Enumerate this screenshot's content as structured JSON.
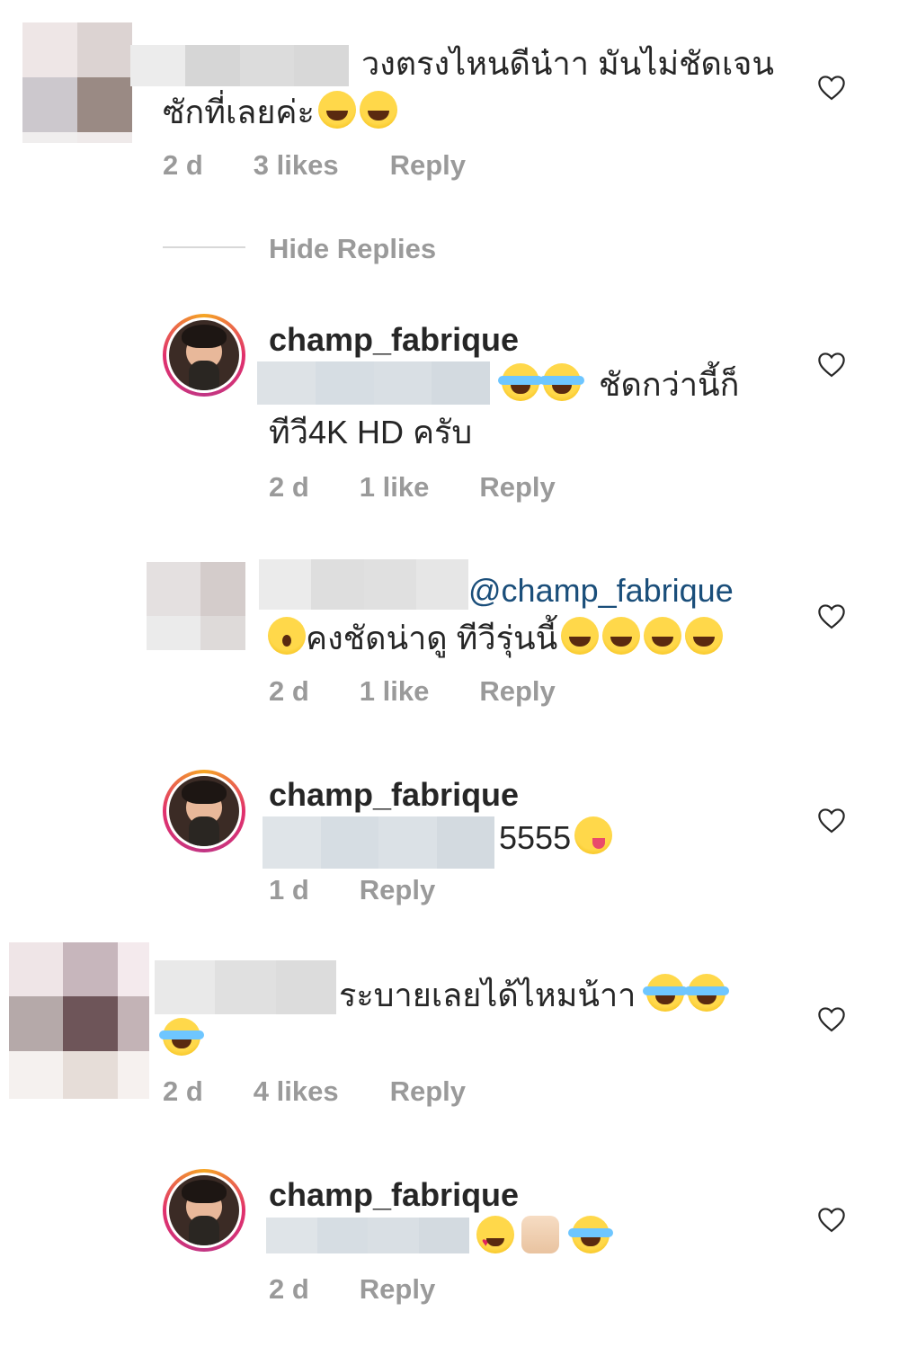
{
  "comments": [
    {
      "line1": "วงตรงไหนดีน๋าา มันไม่ชัดเจน",
      "line2": "ซักที่เลยค่ะ",
      "time": "2 d",
      "likes": "3 likes",
      "reply": "Reply"
    },
    {
      "hide_replies": "Hide Replies"
    },
    {
      "username": "champ_fabrique",
      "line1": "ชัดกว่านี้ก็",
      "line2": "ทีวี4K HD ครับ",
      "time": "2 d",
      "likes": "1 like",
      "reply": "Reply"
    },
    {
      "mention": "@champ_fabrique",
      "line2": "คงชัดน่าดู ทีวีรุ่นนี้",
      "time": "2 d",
      "likes": "1 like",
      "reply": "Reply"
    },
    {
      "username": "champ_fabrique",
      "line1": "5555",
      "time": "1 d",
      "reply": "Reply"
    },
    {
      "line1": "ระบายเลยได้ไหมน้าา",
      "time": "2 d",
      "likes": "4 likes",
      "reply": "Reply"
    },
    {
      "username": "champ_fabrique",
      "time": "2 d",
      "reply": "Reply"
    }
  ],
  "icons": {
    "like": "heart-outline-icon",
    "emoji_laugh": "grinning-squinting-face",
    "emoji_cry": "face-with-tears-of-joy",
    "emoji_wow": "face-with-open-mouth",
    "emoji_yum": "face-savoring-food",
    "emoji_heart_eyes": "smiling-face-with-heart-eyes",
    "emoji_hands": "raising-hands"
  },
  "colors": {
    "text": "#262626",
    "meta": "#9a9a9a",
    "mention": "#1a4e7a",
    "heart_stroke": "#262626"
  }
}
